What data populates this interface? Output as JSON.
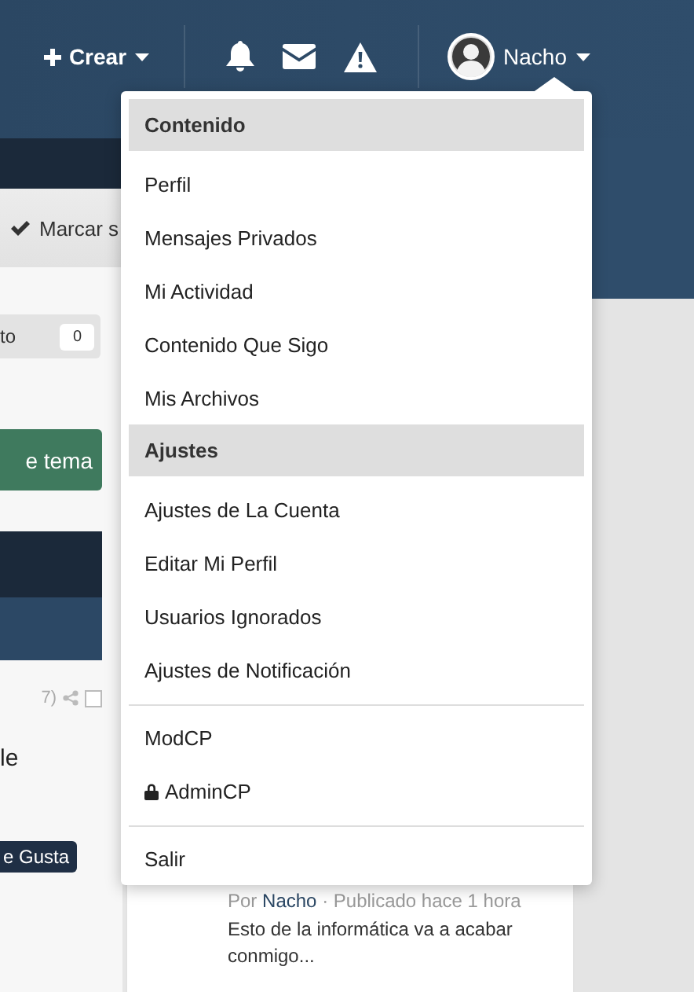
{
  "header": {
    "create_label": "Crear",
    "user_name": "Nacho"
  },
  "user_menu": {
    "open": true,
    "groups": [
      {
        "heading": "Contenido",
        "items": [
          {
            "label": "Perfil",
            "locked": false
          },
          {
            "label": "Mensajes Privados",
            "locked": false
          },
          {
            "label": "Mi Actividad",
            "locked": false
          },
          {
            "label": "Contenido Que Sigo",
            "locked": false
          },
          {
            "label": "Mis Archivos",
            "locked": false
          }
        ]
      },
      {
        "heading": "Ajustes",
        "items": [
          {
            "label": "Ajustes de La Cuenta",
            "locked": false
          },
          {
            "label": "Editar Mi Perfil",
            "locked": false
          },
          {
            "label": "Usuarios Ignorados",
            "locked": false
          },
          {
            "label": "Ajustes de Notificación",
            "locked": false
          }
        ]
      },
      {
        "items": [
          {
            "label": "ModCP",
            "locked": false
          },
          {
            "label": "AdminCP",
            "locked": true
          }
        ]
      },
      {
        "items": [
          {
            "label": "Salir",
            "locked": false
          }
        ]
      }
    ]
  },
  "left_column": {
    "toolbar_action": "Marcar s",
    "follow_label": "to",
    "follow_count": "0",
    "button": "e tema",
    "post_meta": "7)",
    "post_checked": false,
    "post_text": "le",
    "tag": "e Gusta"
  },
  "activity_card": {
    "meta_prefix": "Por",
    "author": "Nacho",
    "meta_suffix": "· Publicado hace 1 hora",
    "excerpt": "Esto de la informática va a acabar conmigo..."
  }
}
